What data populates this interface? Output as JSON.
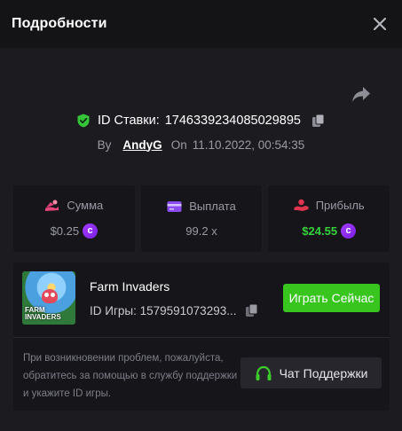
{
  "header": {
    "title": "Подробности"
  },
  "bet": {
    "id_label": "ID Ставки:",
    "id_value": "1746339234085029895",
    "by_label": "By",
    "user": "AndyG",
    "on_label": "On",
    "datetime": "11.10.2022, 00:54:35"
  },
  "stats": {
    "amount": {
      "label": "Сумма",
      "value": "$0.25",
      "coin": "c"
    },
    "payout": {
      "label": "Выплата",
      "value": "99.2 x"
    },
    "profit": {
      "label": "Прибыль",
      "value": "$24.55",
      "coin": "c"
    }
  },
  "game": {
    "name": "Farm Invaders",
    "id_label": "ID Игры:",
    "id_value": "1579591073293...",
    "thumb_text_top": "FARM",
    "thumb_text_mid": "INVADERS",
    "play_label": "Играть Сейчас"
  },
  "support": {
    "text": "При возникновении проблем, пожалуйста, обратитесь за помощью в службу поддержки и укажите ID игры.",
    "button_label": "Чат Поддержки"
  },
  "colors": {
    "accent_green": "#37c51e",
    "profit_green": "#35d23a",
    "coin_purple": "#8a2be2",
    "background": "#1c1c20",
    "panel": "#15151a"
  },
  "icons": {
    "close": "close-icon",
    "share": "share-icon",
    "shield": "shield-check-icon",
    "copy": "copy-icon",
    "amount": "coins-icon",
    "payout": "credit-card-icon",
    "profit": "hand-coin-icon",
    "headset": "headset-icon"
  }
}
